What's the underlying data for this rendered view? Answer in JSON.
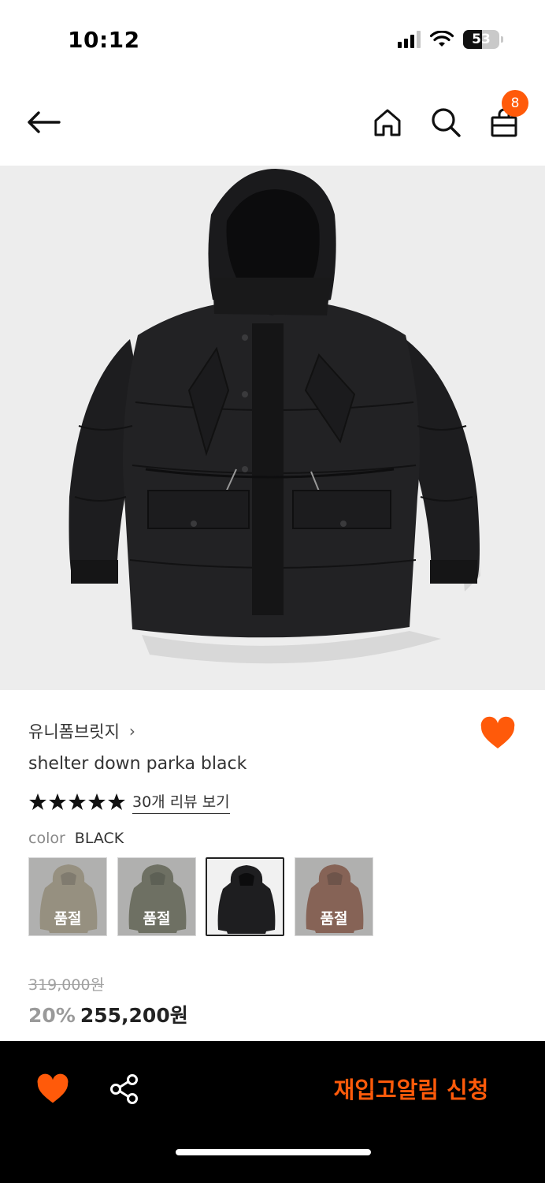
{
  "status_bar": {
    "time": "10:12",
    "battery": "53"
  },
  "nav": {
    "back_icon": "arrow-left-icon",
    "home_icon": "home-icon",
    "search_icon": "search-icon",
    "cart_icon": "shopping-bag-icon",
    "cart_count": "8"
  },
  "product": {
    "brand": "유니폼브릿지",
    "brand_chevron": "›",
    "name": "shelter down parka black",
    "rating_stars": 5,
    "review_link": "30개 리뷰 보기",
    "color_label": "color",
    "color_value": "BLACK",
    "swatches": [
      {
        "color": "beige",
        "sold_out_label": "품절"
      },
      {
        "color": "khaki",
        "sold_out_label": "품절"
      },
      {
        "color": "black",
        "selected": true
      },
      {
        "color": "brown",
        "sold_out_label": "품절"
      }
    ],
    "original_price": "319,000원",
    "discount": "20%",
    "sale_price": "255,200원"
  },
  "bottom_bar": {
    "wish_icon": "heart-icon",
    "share_icon": "share-icon",
    "restock_label": "재입고알림 신청"
  },
  "colors": {
    "accent": "#ff5a0a",
    "bottom_bar_bg": "#000000",
    "image_bg": "#ededed"
  }
}
